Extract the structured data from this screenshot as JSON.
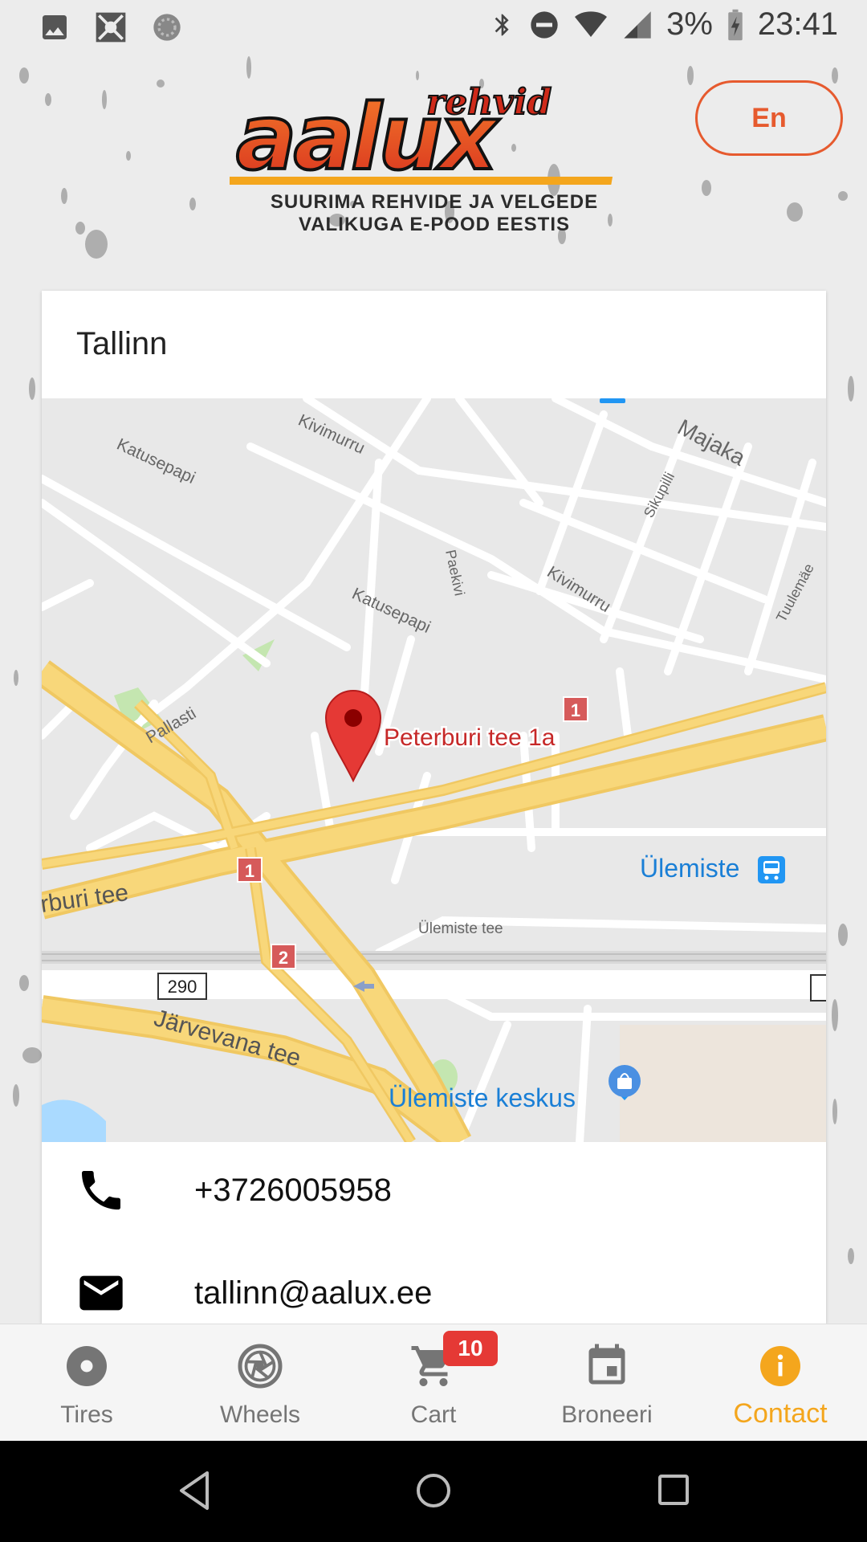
{
  "status_bar": {
    "battery_percent": "3%",
    "time": "23:41"
  },
  "brand": {
    "logo_word": "aalux",
    "logo_script": "rehvid",
    "tagline_line1": "SUURIMA REHVIDE JA VELGEDE",
    "tagline_line2": "VALIKUGA E-POOD EESTIS"
  },
  "language_button": "En",
  "location": {
    "city": "Tallinn",
    "phone": "+3726005958",
    "email": "tallinn@aalux.ee"
  },
  "map": {
    "marker_label": "Peterburi tee 1a",
    "streets": {
      "kivimurru_1": "Kivimurru",
      "katusepapi_1": "Katusepapi",
      "majaka": "Majaka",
      "sikupilli": "Sikupilli",
      "paekivi": "Paekivi",
      "katusepapi_2": "Katusepapi",
      "kivimurru_2": "Kivimurru",
      "tuulemae": "Tuulemäe",
      "pallasti": "Pallasti",
      "peterburi_tee": "rburi tee",
      "ulemiste_tee": "Ülemiste tee",
      "jarvevana_tee": "Järvevana tee"
    },
    "places": {
      "ulemiste_station": "Ülemiste",
      "ulemiste_keskus": "Ülemiste keskus"
    },
    "road_shields": {
      "exit_1a": "1",
      "exit_1b": "1",
      "exit_2": "2",
      "route_290": "290"
    },
    "colors": {
      "highway": "#f8d77a",
      "marker": "#e53935",
      "transit": "#2196f3"
    }
  },
  "bottom_nav": {
    "items": [
      {
        "label": "Tires"
      },
      {
        "label": "Wheels"
      },
      {
        "label": "Cart"
      },
      {
        "label": "Broneeri"
      },
      {
        "label": "Contact"
      }
    ],
    "cart_count": "10",
    "active_color": "#f4a61d"
  }
}
